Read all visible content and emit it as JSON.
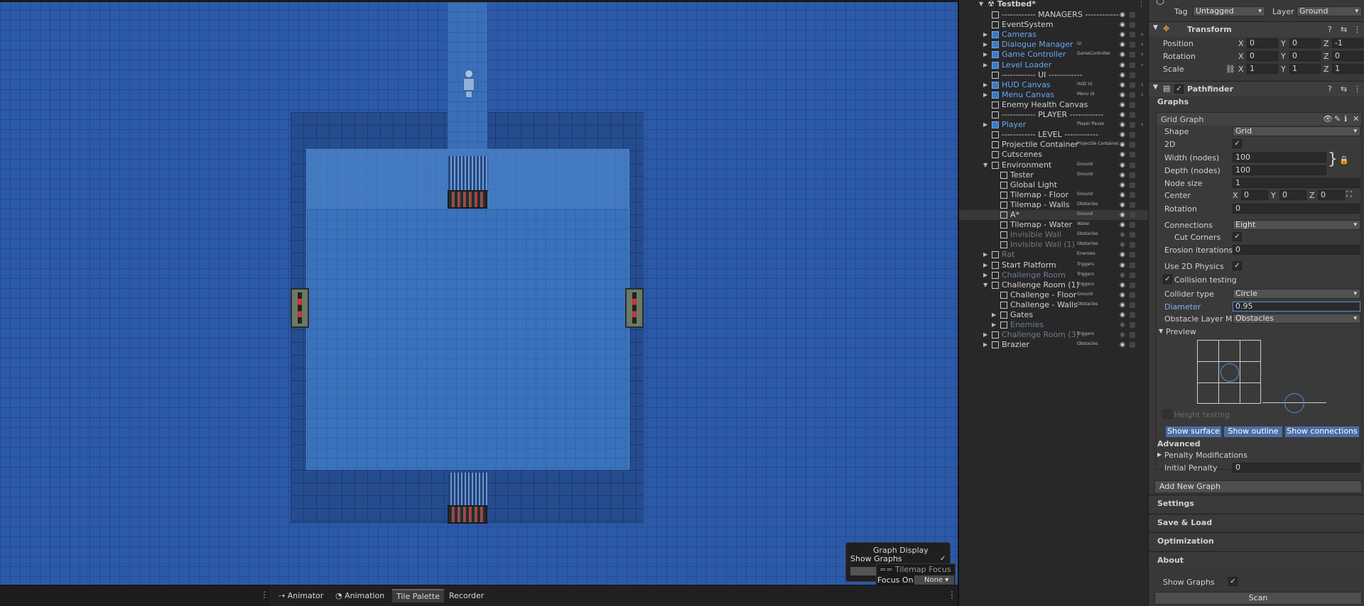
{
  "scene": {
    "graph_display": {
      "title": "Graph Display",
      "show_graphs_label": "Show Graphs",
      "show_graphs_checked": true
    },
    "tilemap_focus": {
      "title": "Tilemap Focus",
      "focus_on_label": "Focus On",
      "focus_on_value": "None"
    }
  },
  "bottom_tabs": [
    {
      "label": "Animator",
      "icon": "animator-icon"
    },
    {
      "label": "Animation",
      "icon": "animation-icon"
    },
    {
      "label": "Tile Palette",
      "active": true
    },
    {
      "label": "Recorder"
    }
  ],
  "hierarchy": {
    "scene_name": "Testbed*",
    "items": [
      {
        "label": "------------ MANAGERS ------------",
        "tag": ""
      },
      {
        "label": "EventSystem",
        "tag": ""
      },
      {
        "label": "Cameras",
        "tag": "",
        "prefab": true
      },
      {
        "label": "Dialogue Manager",
        "tag": "UI",
        "prefab": true
      },
      {
        "label": "Game Controller",
        "tag": "GameController",
        "prefab": true
      },
      {
        "label": "Level Loader",
        "tag": "",
        "prefab": true
      },
      {
        "label": "------------ UI ------------",
        "tag": ""
      },
      {
        "label": "HUD Canvas",
        "tag": "HUD UI",
        "prefab": true
      },
      {
        "label": "Menu Canvas",
        "tag": "Menu UI",
        "prefab": true
      },
      {
        "label": "Enemy Health Canvas",
        "tag": ""
      },
      {
        "label": "------------ PLAYER ------------",
        "tag": ""
      },
      {
        "label": "Player",
        "tag": "Player Pause",
        "prefab": true
      },
      {
        "label": "------------ LEVEL ------------",
        "tag": ""
      },
      {
        "label": "Projectile Container",
        "tag": "Projectile Container"
      },
      {
        "label": "Cutscenes",
        "tag": ""
      },
      {
        "label": "Environment",
        "tag": "Ground"
      },
      {
        "label": "Tester",
        "tag": "Ground"
      },
      {
        "label": "Global Light",
        "tag": ""
      },
      {
        "label": "Tilemap - Floor",
        "tag": "Ground"
      },
      {
        "label": "Tilemap - Walls",
        "tag": "Obstacles"
      },
      {
        "label": "A*",
        "tag": "Ground"
      },
      {
        "label": "Tilemap - Water",
        "tag": "Water"
      },
      {
        "label": "Invisible Wall",
        "tag": "Obstacles"
      },
      {
        "label": "Invisible Wall (1)",
        "tag": "Obstacles"
      },
      {
        "label": "Rat",
        "tag": "Enemies"
      },
      {
        "label": "Start Platform",
        "tag": "Triggers"
      },
      {
        "label": "Challenge Room",
        "tag": "Triggers"
      },
      {
        "label": "Challenge Room (1)",
        "tag": "Triggers"
      },
      {
        "label": "Challenge - Floor",
        "tag": "Ground"
      },
      {
        "label": "Challenge - Walls",
        "tag": "Obstacles"
      },
      {
        "label": "Gates",
        "tag": ""
      },
      {
        "label": "Enemies",
        "tag": ""
      },
      {
        "label": "Challenge Room (3)",
        "tag": "Triggers"
      },
      {
        "label": "Brazier",
        "tag": "Obstacles"
      }
    ]
  },
  "inspector": {
    "tag_label": "Tag",
    "tag_value": "Untagged",
    "layer_label": "Layer",
    "layer_value": "Ground",
    "transform": {
      "title": "Transform",
      "position_label": "Position",
      "position": [
        "0",
        "0",
        "-1"
      ],
      "rotation_label": "Rotation",
      "rotation": [
        "0",
        "0",
        "0"
      ],
      "scale_label": "Scale",
      "scale": [
        "1",
        "1",
        "1"
      ],
      "axis_x": "X",
      "axis_y": "Y",
      "axis_z": "Z"
    },
    "pathfinder": {
      "title": "Pathfinder",
      "graphs_label": "Graphs",
      "grid_graph_label": "Grid Graph",
      "shape_label": "Shape",
      "shape_value": "Grid",
      "twod_label": "2D",
      "twod_checked": true,
      "width_label": "Width (nodes)",
      "width_value": "100",
      "depth_label": "Depth (nodes)",
      "depth_value": "100",
      "node_size_label": "Node size",
      "node_size_value": "1",
      "center_label": "Center",
      "center": [
        "0",
        "0",
        "0"
      ],
      "rotation_label": "Rotation",
      "rotation_value": "0",
      "connections_label": "Connections",
      "connections_value": "Eight",
      "cut_corners_label": "Cut Corners",
      "cut_corners_checked": true,
      "erosion_label": "Erosion iterations",
      "erosion_value": "0",
      "use_2d_physics_label": "Use 2D Physics",
      "use_2d_physics_checked": true,
      "collision_testing_label": "Collision testing",
      "collision_testing_checked": true,
      "collider_type_label": "Collider type",
      "collider_type_value": "Circle",
      "diameter_label": "Diameter",
      "diameter_value": "0.95",
      "obstacle_layer_label": "Obstacle Layer Ma",
      "obstacle_layer_value": "Obstacles",
      "preview_label": "Preview",
      "height_testing_label": "Height testing",
      "show_surface_label": "Show surface",
      "show_outline_label": "Show outline",
      "show_connections_label": "Show connections",
      "advanced_label": "Advanced",
      "penalty_modifications_label": "Penalty Modifications",
      "initial_penalty_label": "Initial Penalty",
      "initial_penalty_value": "0",
      "add_new_graph_label": "Add New Graph",
      "settings_label": "Settings",
      "save_load_label": "Save & Load",
      "optimization_label": "Optimization",
      "about_label": "About",
      "show_graphs_label": "Show Graphs",
      "show_graphs_checked": true,
      "scan_label": "Scan"
    }
  }
}
